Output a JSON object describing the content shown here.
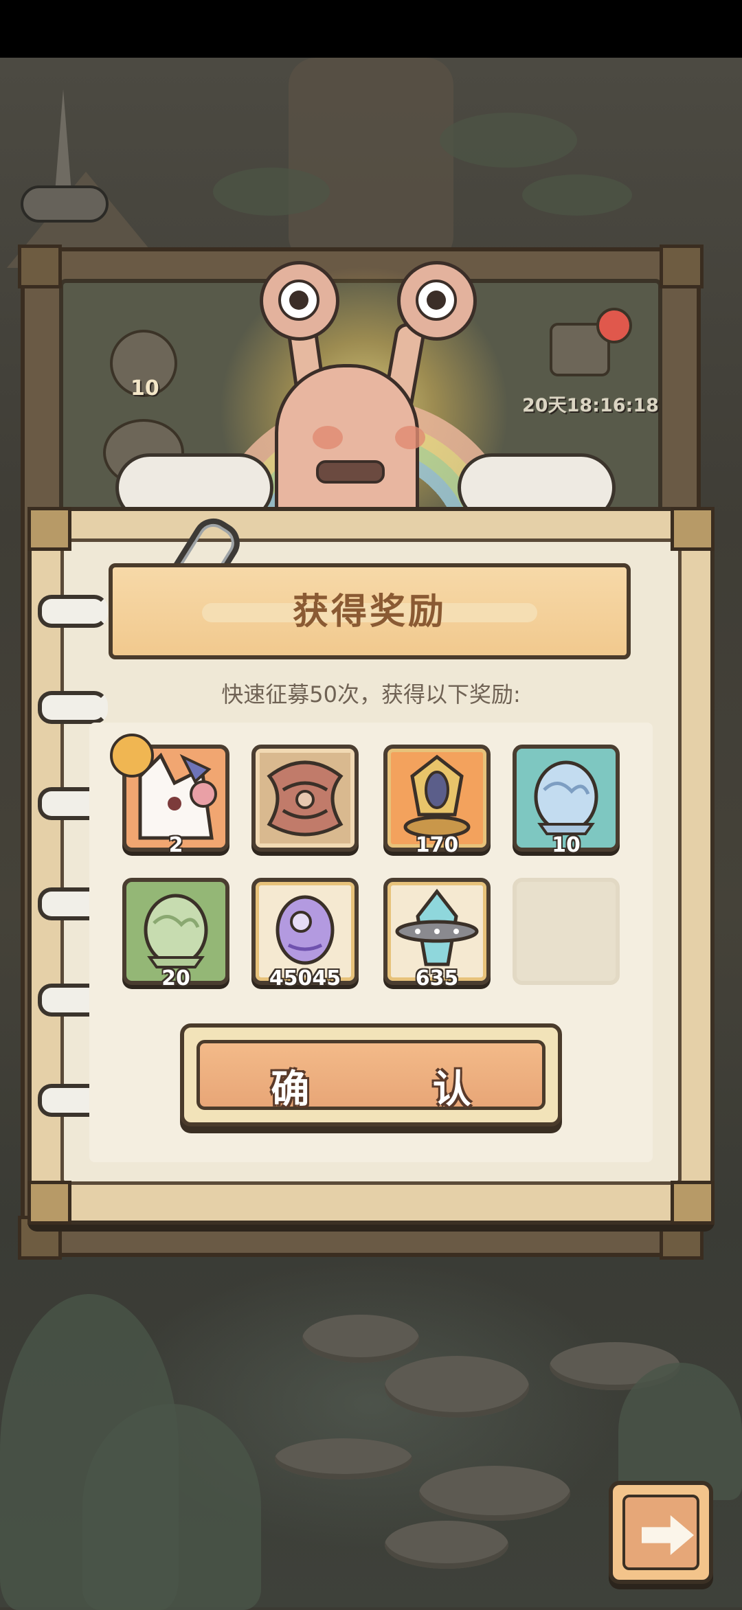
{
  "popup": {
    "title": "获得奖励",
    "subtitle": "快速征募50次，获得以下奖励:",
    "confirm_label": "确 认"
  },
  "background": {
    "timer_text": "20天18:16:18",
    "left_badge_count": "10"
  },
  "rewards": [
    {
      "icon": "fox-hero-card-icon",
      "count": "2",
      "bg": "#f1a671"
    },
    {
      "icon": "dragon-skin-card-icon",
      "count": "",
      "bg": "#f1d9b3"
    },
    {
      "icon": "golden-mirror-relic-icon",
      "count": "170",
      "bg": "#f3a25d"
    },
    {
      "icon": "blue-spirit-egg-icon",
      "count": "10",
      "bg": "#7ec7c1"
    },
    {
      "icon": "green-spirit-egg-icon",
      "count": "20",
      "bg": "#94b776"
    },
    {
      "icon": "purple-spirit-egg-icon",
      "count": "45045",
      "bg": "#f5e9d1"
    },
    {
      "icon": "cyan-crystal-icon",
      "count": "635",
      "bg": "#f5e9d1"
    },
    {
      "icon": "empty-slot",
      "count": "",
      "bg": "#e8e0cc"
    }
  ],
  "colors": {
    "title_text": "#8a5a33",
    "button_orange": "#e8a677",
    "panel_paper": "#efe8d6"
  }
}
